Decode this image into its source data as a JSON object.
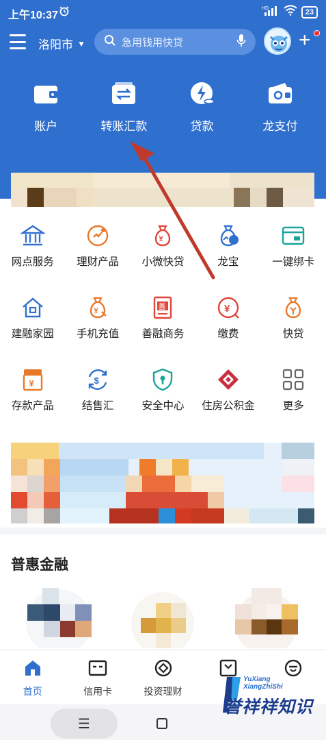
{
  "status_bar": {
    "time": "上午10:37",
    "battery": "23",
    "network": "HD"
  },
  "header": {
    "city": "洛阳市",
    "search_placeholder": "急用钱用快贷"
  },
  "quick_actions": [
    {
      "label": "账户",
      "icon": "wallet-icon"
    },
    {
      "label": "转账汇款",
      "icon": "transfer-icon"
    },
    {
      "label": "贷款",
      "icon": "loan-icon"
    },
    {
      "label": "龙支付",
      "icon": "long-pay-icon"
    }
  ],
  "services": [
    [
      {
        "label": "网点服务",
        "icon": "bank-branch-icon",
        "color": "#2f6fce"
      },
      {
        "label": "理财产品",
        "icon": "wealth-product-icon",
        "color": "#e8792b"
      },
      {
        "label": "小微快贷",
        "icon": "money-bag-icon",
        "color": "#e0463a"
      },
      {
        "label": "龙宝",
        "icon": "dragon-treasure-icon",
        "color": "#2f6fce"
      },
      {
        "label": "一键绑卡",
        "icon": "bind-card-icon",
        "color": "#1aa39a"
      }
    ],
    [
      {
        "label": "建融家园",
        "icon": "home-icon",
        "color": "#2f6fce"
      },
      {
        "label": "手机充值",
        "icon": "phone-topup-icon",
        "color": "#e8792b"
      },
      {
        "label": "善融商务",
        "icon": "shanrong-icon",
        "color": "#e0463a"
      },
      {
        "label": "缴费",
        "icon": "payment-icon",
        "color": "#e0463a"
      },
      {
        "label": "快贷",
        "icon": "quick-loan-icon",
        "color": "#e8792b"
      }
    ],
    [
      {
        "label": "存款产品",
        "icon": "deposit-icon",
        "color": "#e8792b"
      },
      {
        "label": "结售汇",
        "icon": "exchange-icon",
        "color": "#2f6fce"
      },
      {
        "label": "安全中心",
        "icon": "shield-icon",
        "color": "#1aa39a"
      },
      {
        "label": "住房公积金",
        "icon": "housing-fund-icon",
        "color": "#c8303f"
      },
      {
        "label": "更多",
        "icon": "more-grid-icon",
        "color": "#666666"
      }
    ]
  ],
  "section": {
    "title": "普惠金融"
  },
  "tabbar": [
    {
      "label": "首页",
      "icon": "home-tab-icon",
      "active": true
    },
    {
      "label": "信用卡",
      "icon": "credit-card-icon",
      "active": false
    },
    {
      "label": "投资理财",
      "icon": "investment-icon",
      "active": false
    },
    {
      "label": "",
      "icon": "tab-icon-4",
      "active": false
    },
    {
      "label": "",
      "icon": "tab-icon-5",
      "active": false
    }
  ],
  "watermark": {
    "line1": "YuXiang",
    "line2": "XiangZhiShi",
    "text": "誉祥祥知识"
  },
  "colors": {
    "primary": "#2f6fce",
    "annotation_arrow": "#c0392b"
  }
}
